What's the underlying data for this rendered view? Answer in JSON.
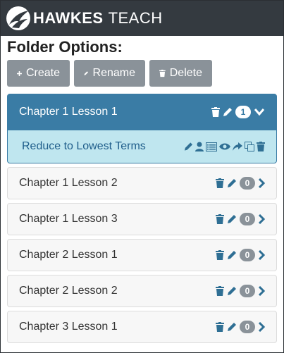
{
  "app": {
    "brand_strong": "HAWKES",
    "brand_light": "TEACH"
  },
  "page": {
    "heading": "Folder Options:"
  },
  "toolbar": {
    "create_label": "Create",
    "rename_label": "Rename",
    "delete_label": "Delete"
  },
  "active_folder": {
    "label": "Chapter 1 Lesson 1",
    "count": "1"
  },
  "active_lesson": {
    "label": "Reduce to Lowest Terms"
  },
  "folders": [
    {
      "label": "Chapter 1 Lesson 2",
      "count": "0"
    },
    {
      "label": "Chapter 1 Lesson 3",
      "count": "0"
    },
    {
      "label": "Chapter 2 Lesson 1",
      "count": "0"
    },
    {
      "label": "Chapter 2 Lesson 2",
      "count": "0"
    },
    {
      "label": "Chapter 3 Lesson 1",
      "count": "0"
    }
  ],
  "colors": {
    "topbar": "#343a40",
    "accent": "#3a7ca5",
    "lesson_bg": "#bfe6ef",
    "button": "#8a9299"
  },
  "icons": [
    "trash-icon",
    "pencil-icon",
    "chevron-down-icon",
    "chevron-right-icon",
    "user-icon",
    "list-icon",
    "eye-icon",
    "share-icon",
    "copy-icon",
    "plus-icon"
  ]
}
